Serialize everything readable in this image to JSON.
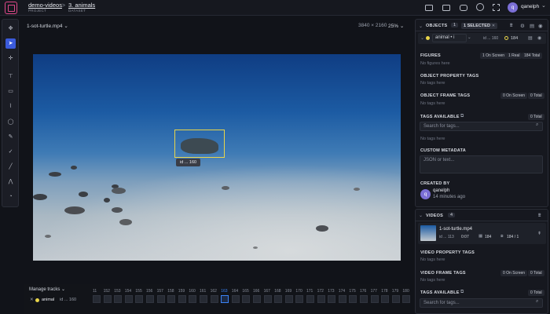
{
  "header": {
    "project_name": "demo-videos",
    "project_label": "PROJECT",
    "separator": ">",
    "dataset_name": "3. animals",
    "dataset_label": "DATASET",
    "user_initial": "q",
    "user_name": "qanelph",
    "user_chevron": "⌄"
  },
  "canvas": {
    "file_name": "1-sot-turtle.mp4",
    "file_chevron": "⌄",
    "resolution": "3840 × 2160",
    "zoom": "25%",
    "zoom_chevron": "⌄",
    "bbox_label": "id ... 160"
  },
  "timeline": {
    "manage_tracks": "Manage tracks",
    "manage_chevron": "⌄",
    "frames": [
      "11",
      "152",
      "153",
      "154",
      "155",
      "156",
      "157",
      "158",
      "159",
      "160",
      "161",
      "162",
      "163",
      "164",
      "165",
      "166",
      "167",
      "168",
      "169",
      "170",
      "171",
      "172",
      "173",
      "174",
      "175",
      "176",
      "177",
      "178",
      "179",
      "180"
    ],
    "selected_frame": "163",
    "track": {
      "close": "✕",
      "class": "animal",
      "id": "id ... 160"
    }
  },
  "objects_panel": {
    "title": "OBJECTS",
    "count": "1",
    "selected": "1 SELECTED",
    "selected_close": "✕",
    "object": {
      "class": "animal • i",
      "id": "id ... 160",
      "score": "184"
    },
    "figures": {
      "title": "FIGURES",
      "on_screen": "1 On Screen",
      "real": "1 Real",
      "total": "184 Total",
      "empty": "No figures here"
    },
    "object_property_tags": {
      "title": "OBJECT PROPERTY TAGS",
      "empty": "No tags here"
    },
    "object_frame_tags": {
      "title": "OBJECT FRAME TAGS",
      "on_screen": "0 On Screen",
      "total": "0 Total",
      "empty": "No tags here"
    },
    "tags_available": {
      "title": "TAGS AVAILABLE",
      "total": "0 Total",
      "search_placeholder": "Search for tags...",
      "empty": "No tags here"
    },
    "custom_metadata": {
      "title": "CUSTOM METADATA",
      "placeholder": "JSON or text..."
    },
    "created_by": {
      "title": "CREATED BY",
      "user_initial": "q",
      "user": "qanelph",
      "time": "14 minutes ago"
    }
  },
  "videos_panel": {
    "title": "VIDEOS",
    "count": "4",
    "video": {
      "name": "1-sot-turtle.mp4",
      "id": "id ... 113",
      "duration": "0:07",
      "frames": "184",
      "ratio": "184 / 1"
    },
    "video_property_tags": {
      "title": "VIDEO PROPERTY TAGS",
      "empty": "No tags here"
    },
    "video_frame_tags": {
      "title": "VIDEO FRAME TAGS",
      "on_screen": "0 On Screen",
      "total": "0 Total",
      "empty": "No tags here"
    },
    "tags_available": {
      "title": "TAGS AVAILABLE",
      "total": "0 Total",
      "search_placeholder": "Search for tags..."
    }
  },
  "colors": {
    "accent": "#3b5bdb",
    "brand": "#e0488a",
    "bbox": "#e9d54a",
    "status_dot": "#e9d54a"
  },
  "icons": [
    "logo-icon",
    "fullscreen-icon",
    "play-icon",
    "camera-icon",
    "settings-icon",
    "expand-icon",
    "chevron-down-icon",
    "pan-icon",
    "cursor-icon",
    "move-icon",
    "text-icon",
    "rectangle-icon",
    "polyline-icon",
    "ellipse-icon",
    "brush-icon",
    "point-icon",
    "line-icon",
    "graph-icon",
    "help-icon",
    "filter-icon",
    "trash-icon",
    "eye-icon",
    "search-icon",
    "chevron-right-icon",
    "link-icon"
  ]
}
